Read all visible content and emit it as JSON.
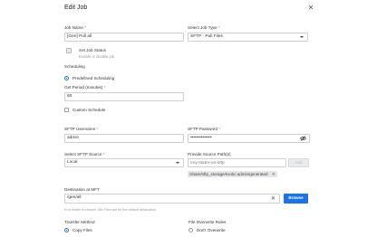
{
  "dialog": {
    "title": "Edit Job",
    "close_icon": "close-icon"
  },
  "job_name": {
    "label": "Job Name",
    "required": "*",
    "value": "[Gen] Pull all"
  },
  "job_type": {
    "label": "Select Job Type",
    "required": "*",
    "value": "SFTP - Pull Files"
  },
  "job_status": {
    "label": "Set Job Status",
    "hint": "Enable or disable job"
  },
  "scheduling": {
    "heading": "Scheduling",
    "predefined": "Predefined Scheduling",
    "period_label": "Get Period (minutes)",
    "period_required": "*",
    "period_value": "60",
    "custom": "Custom Schedule"
  },
  "sftp": {
    "username_label": "SFTP Username",
    "username_required": "*",
    "username_value": "admin",
    "password_label": "SFTP Password",
    "password_required": "*",
    "password_value": "••••••••••••••",
    "source_label": "Select SFTP Source",
    "source_required": "*",
    "source_value": "Local",
    "paths_label": "Provide Source Path(s)",
    "paths_placeholder": "/my-folder-on-sftp",
    "add_label": "Add",
    "path_chip": "/share/sftp_storage/exotic.admin/generated"
  },
  "destination": {
    "label": "Destination at MFT",
    "value": "/gen/all",
    "browse_label": "Browse",
    "hint": "If no folder is chosen, Me Files will be the default destination"
  },
  "transfer": {
    "label": "Transfer Method",
    "option": "Copy Files"
  },
  "overwrite": {
    "label": "File Overwrite Rules",
    "option": "Don't Overwrite"
  }
}
